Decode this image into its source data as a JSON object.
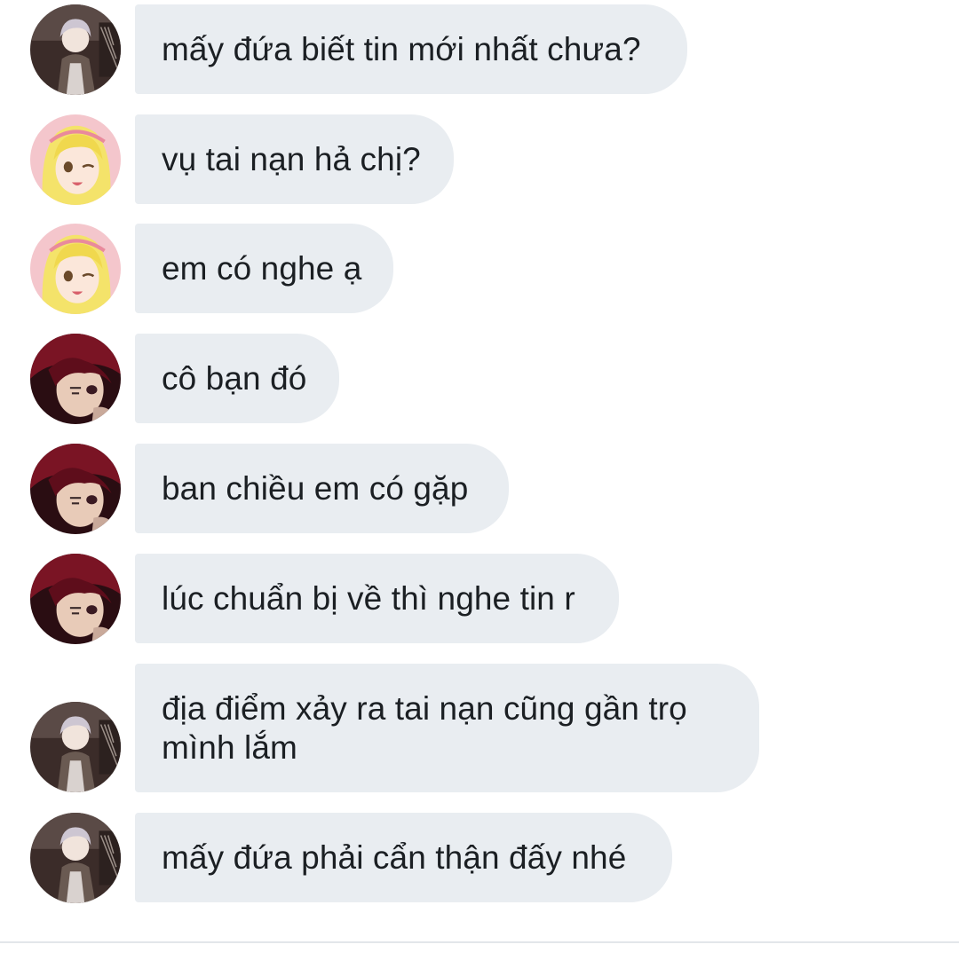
{
  "messages": [
    {
      "avatar": "silver-hair-avatar",
      "text": "mấy đứa biết tin mới nhất chưa?"
    },
    {
      "avatar": "blonde-girl-avatar",
      "text": "vụ tai nạn hả chị?"
    },
    {
      "avatar": "blonde-girl-avatar",
      "text": "em có nghe ạ"
    },
    {
      "avatar": "red-hair-avatar",
      "text": "cô bạn đó"
    },
    {
      "avatar": "red-hair-avatar",
      "text": "ban chiều em có gặp"
    },
    {
      "avatar": "red-hair-avatar",
      "text": "lúc chuẩn bị về thì nghe tin r"
    },
    {
      "avatar": "silver-hair-avatar",
      "text": "địa điểm xảy ra tai nạn cũng gần trọ\nmình lắm"
    },
    {
      "avatar": "silver-hair-avatar",
      "text": "mấy đứa phải cẩn thận đấy nhé"
    }
  ],
  "colors": {
    "bubble": "#e9edf1",
    "text": "#1b1f23",
    "background": "#ffffff"
  }
}
